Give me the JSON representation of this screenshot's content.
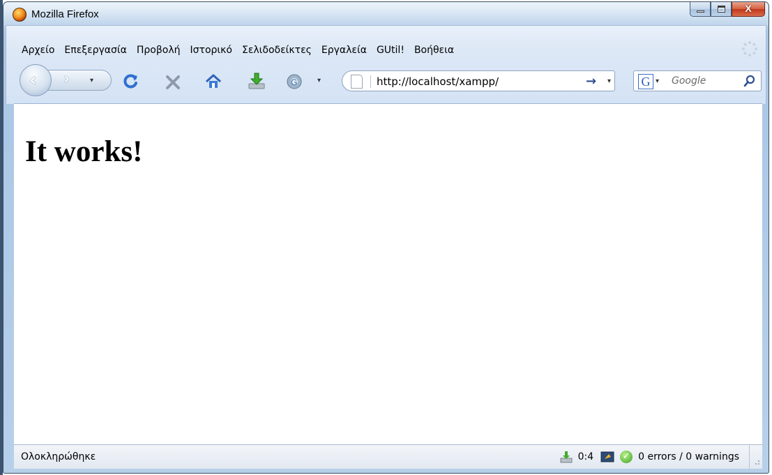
{
  "window": {
    "title": "Mozilla Firefox",
    "close_glyph": "X"
  },
  "menu": [
    {
      "label": "Αρχείο"
    },
    {
      "label": "Επεξεργασία"
    },
    {
      "label": "Προβολή"
    },
    {
      "label": "Ιστορικό"
    },
    {
      "label": "Σελιδοδείκτες"
    },
    {
      "label": "Εργαλεία"
    },
    {
      "label": "GUtil!"
    },
    {
      "label": "Βοήθεια"
    }
  ],
  "toolbar": {
    "url": "http://localhost/xampp/",
    "search_engine_letter": "G",
    "search_placeholder": "Google"
  },
  "page": {
    "heading": "It works!"
  },
  "status": {
    "text": "Ολοκληρώθηκε",
    "count": "0:4",
    "validator": "0 errors / 0 warnings"
  }
}
